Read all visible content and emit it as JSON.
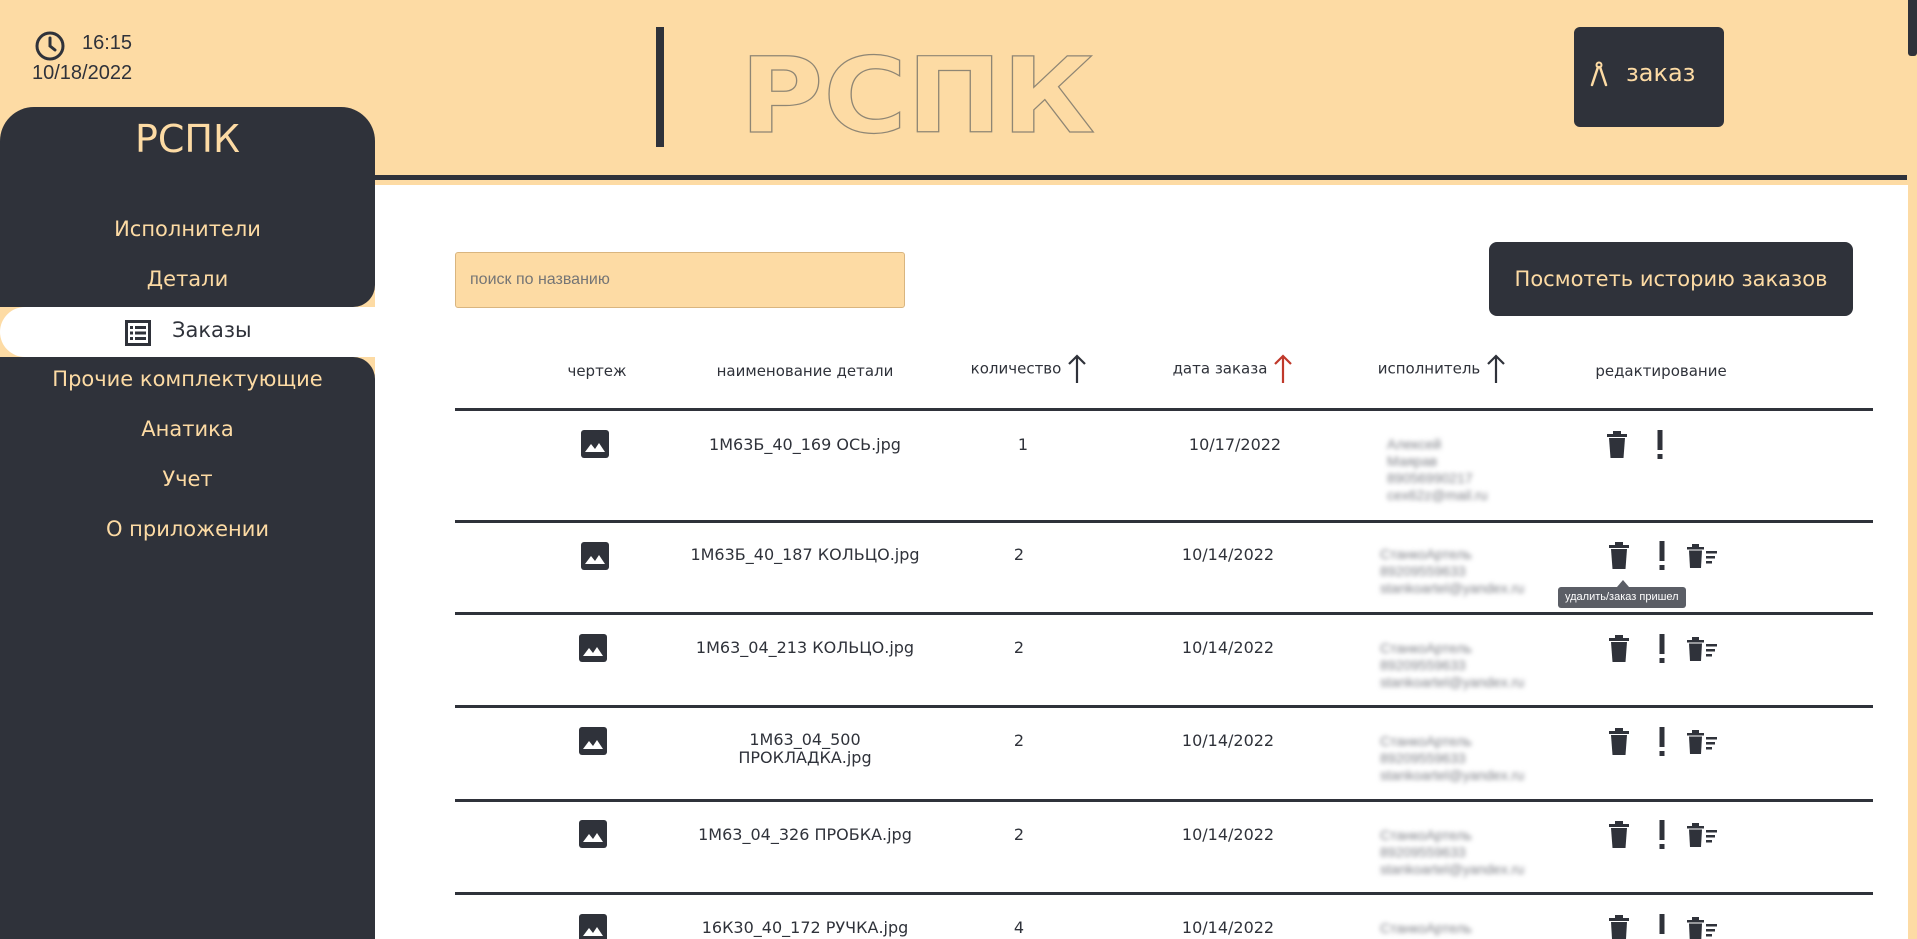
{
  "clock": {
    "time": "16:15",
    "date": "10/18/2022",
    "icon": "clock-icon"
  },
  "header": {
    "logo_text": "РСПК",
    "order_button": "заказ"
  },
  "sidebar": {
    "title": "РСПК",
    "items": [
      {
        "label": "Исполнители"
      },
      {
        "label": "Детали"
      },
      {
        "label": "Заказы",
        "active": true,
        "icon": "table-icon"
      },
      {
        "label": "Прочие комплектующие"
      },
      {
        "label": "Анатика"
      },
      {
        "label": "Учет"
      },
      {
        "label": "О приложении"
      }
    ]
  },
  "main": {
    "search_placeholder": "поиск по названию",
    "history_button": "Посмотеть историю заказов",
    "columns": {
      "drawing": "чертеж",
      "name": "наименование детали",
      "quantity": "количество",
      "date": "дата заказа",
      "performer": "исполнитель",
      "edit": "редактирование"
    },
    "sort_colors": {
      "default": "#2f323a",
      "active": "#c0392b"
    },
    "rows": [
      {
        "name": "1М63Б_40_169 ОСЬ.jpg",
        "quantity": "1",
        "date": "10/17/2022",
        "performer": "Алексей\nМаярав\n89056990217\ncex62z@mail.ru"
      },
      {
        "name": "1М63Б_40_187 КОЛЬЦО.jpg",
        "quantity": "2",
        "date": "10/14/2022",
        "performer": "СтанкоАртель\n89209559633\nstankoartel@yandex.ru"
      },
      {
        "name": "1М63_04_213 КОЛЬЦО.jpg",
        "quantity": "2",
        "date": "10/14/2022",
        "performer": "СтанкоАртель\n89209559633\nstankoartel@yandex.ru"
      },
      {
        "name": "1М63_04_500\nПРОКЛАДКА.jpg",
        "quantity": "2",
        "date": "10/14/2022",
        "performer": "СтанкоАртель\n89209559633\nstankoartel@yandex.ru"
      },
      {
        "name": "1М63_04_326 ПРОБКА.jpg",
        "quantity": "2",
        "date": "10/14/2022",
        "performer": "СтанкоАртель\n89209559633\nstankoartel@yandex.ru"
      },
      {
        "name": "16К30_40_172 РУЧКА.jpg",
        "quantity": "4",
        "date": "10/14/2022",
        "performer": "СтанкоАртель"
      }
    ],
    "tooltip": "удалить/заказ пришел"
  }
}
